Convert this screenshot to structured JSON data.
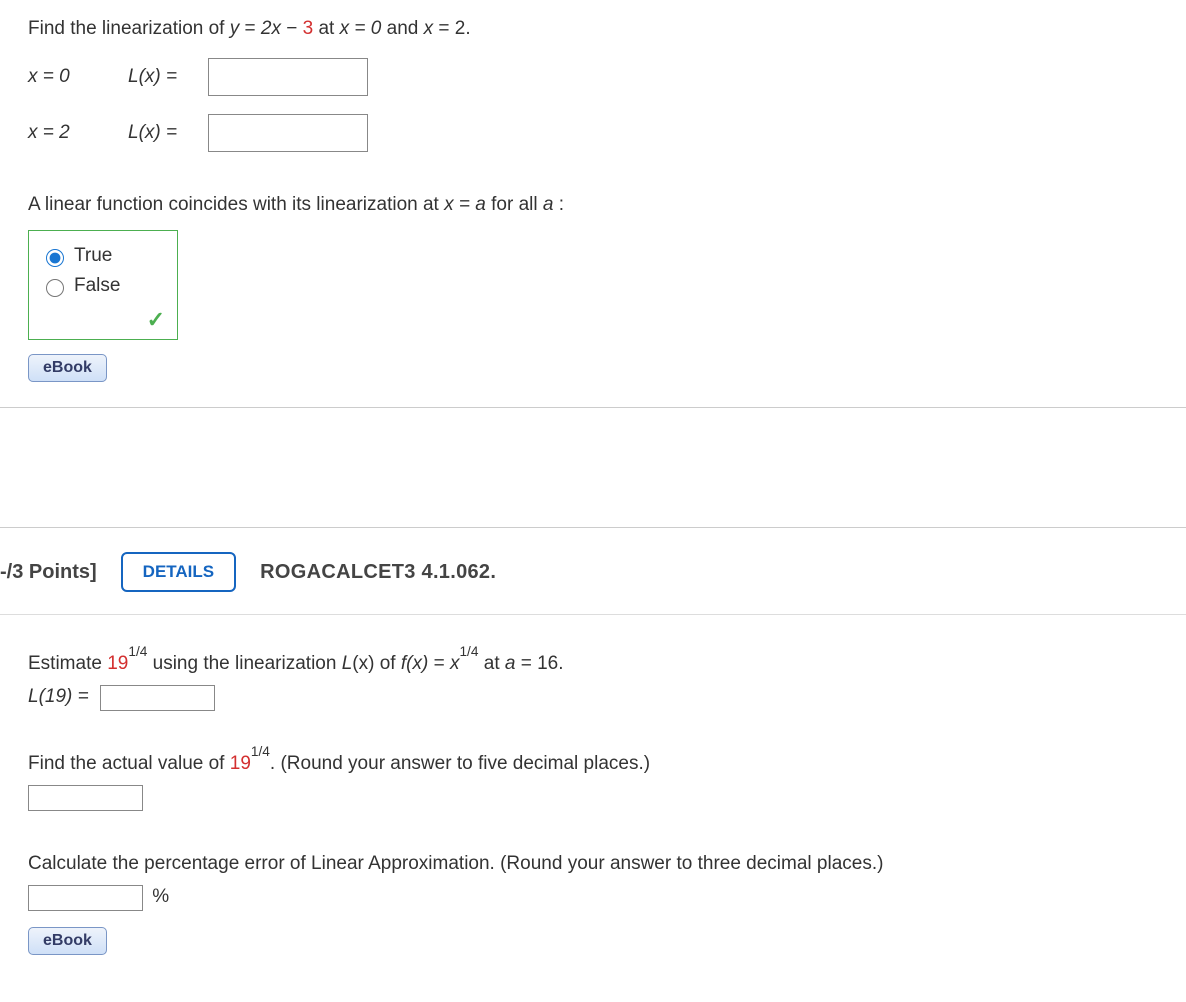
{
  "q1": {
    "prompt_pre": "Find the linearization of  ",
    "eq_y": "y",
    "eq_eq": " = ",
    "eq_2x": "2x",
    "eq_minus": " − ",
    "eq_3": "3",
    "prompt_at": "  at  ",
    "x0": "x = 0",
    "and": "  and  ",
    "x2pre": "x",
    "x2eq": " = 2.",
    "row1_x": "x = 0",
    "row1_l": "L(x) =",
    "row2_x": "x = 2",
    "row2_l": "L(x) =",
    "linear_prompt_pre": "A linear function coincides with its linearization at  ",
    "linear_prompt_mid": "x = a",
    "linear_prompt_post": "  for all  ",
    "linear_prompt_a": "a",
    "linear_prompt_colon": ":",
    "opt_true": "True",
    "opt_false": "False",
    "ebook": "eBook"
  },
  "q2": {
    "points": "-/3 Points]",
    "details": "DETAILS",
    "source": "ROGACALCET3 4.1.062.",
    "p1_pre": "Estimate  ",
    "p1_num": "19",
    "p1_exp": "1/4",
    "p1_mid": "  using the linearization  ",
    "p1_L": "L",
    "p1_of": "(x) of ",
    "p1_f": "f(x)",
    "p1_eq": " = ",
    "p1_x": "x",
    "p1_exp2": "1/4",
    "p1_at": "  at ",
    "p1_a": "a",
    "p1_a16": " = 16.",
    "L19": "L(19) =",
    "p2_pre": "Find the actual value of  ",
    "p2_num": "19",
    "p2_exp": "1/4",
    "p2_post": ".  (Round your answer to five decimal places.)",
    "p3": "Calculate the percentage error of Linear Approximation. (Round your answer to three decimal places.)",
    "percent": "%",
    "ebook": "eBook"
  }
}
